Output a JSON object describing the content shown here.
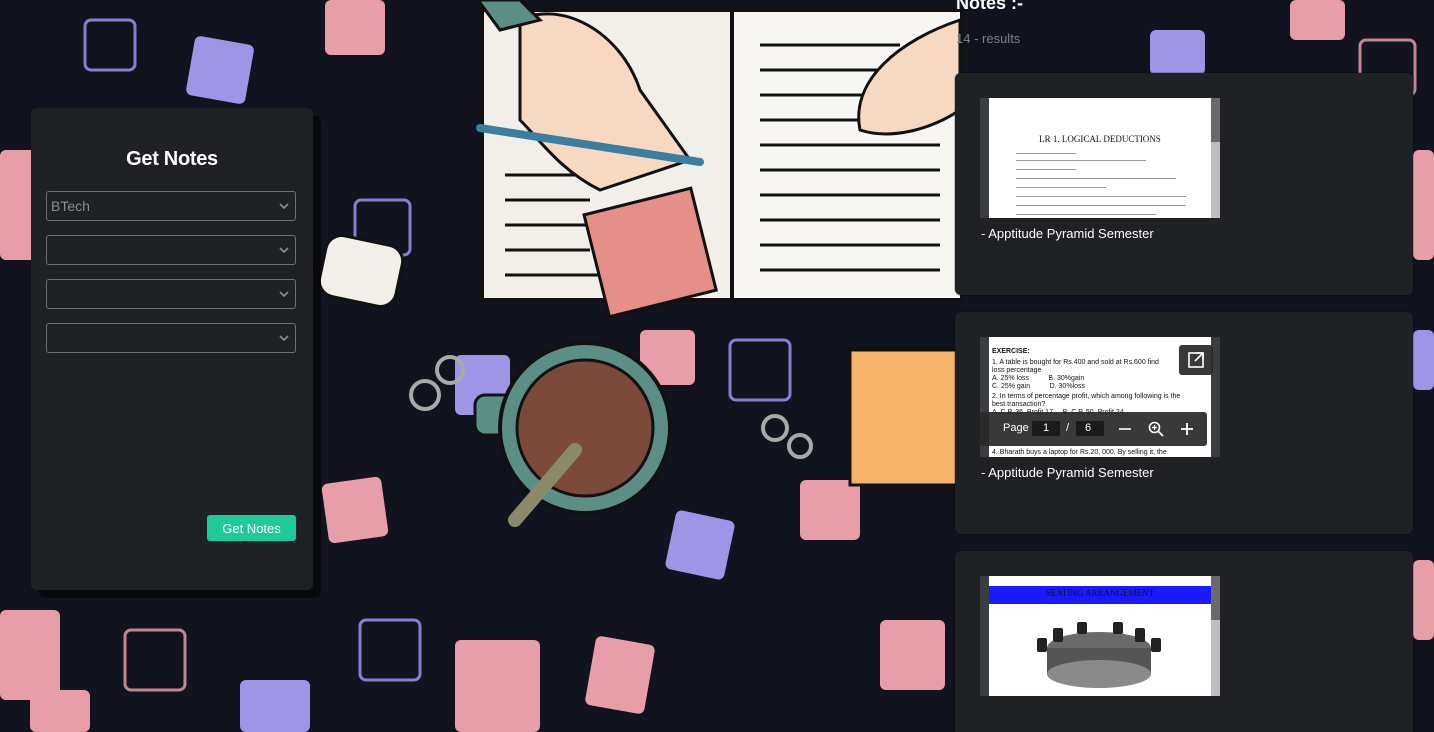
{
  "sidebar": {
    "title": "Get Notes",
    "selects": [
      {
        "value": "BTech"
      },
      {
        "value": ""
      },
      {
        "value": ""
      },
      {
        "value": ""
      }
    ],
    "button_label": "Get Notes"
  },
  "notes": {
    "title": "Notes :-",
    "count": "14 - results",
    "cards": [
      {
        "label": "- Apptitude Pyramid Semester",
        "preview_heading": "LR 1. LOGICAL DEDUCTIONS"
      },
      {
        "label": "- Apptitude Pyramid Semester",
        "preview_heading": "EXERCISE:",
        "preview_lines": [
          "1. A table is bought for Rs.400 and sold at Rs.600 find",
          "loss percentage",
          "A. 25% loss          B. 30%gain",
          "C. 25% gain          D. 30%loss",
          "2. In terms of percentage profit, which among following is the",
          "best transaction?",
          "A. C.P. 36, Profit 17     B. C.P. 50, Profit 24",
          "4. Bharath buys a laptop for Rs.20, 000. By selling it, the"
        ],
        "viewer": {
          "page_label": "Page",
          "current_page": "1",
          "separator": "/",
          "total_pages": "6"
        }
      },
      {
        "label": "",
        "preview_heading": "SEATING ARRANGEMENT"
      }
    ]
  },
  "colors": {
    "background": "#11141f",
    "panel": "#1f2125",
    "accent": "#1ec99a",
    "puzzle_pink": "#f4a6b0",
    "puzzle_purple": "#a79cf2"
  },
  "icons": {
    "select_arrow": "chevron-down-icon",
    "popout": "open-external-icon",
    "zoom_out": "minus-icon",
    "zoom_search": "zoom-in-icon",
    "zoom_in": "plus-icon"
  }
}
